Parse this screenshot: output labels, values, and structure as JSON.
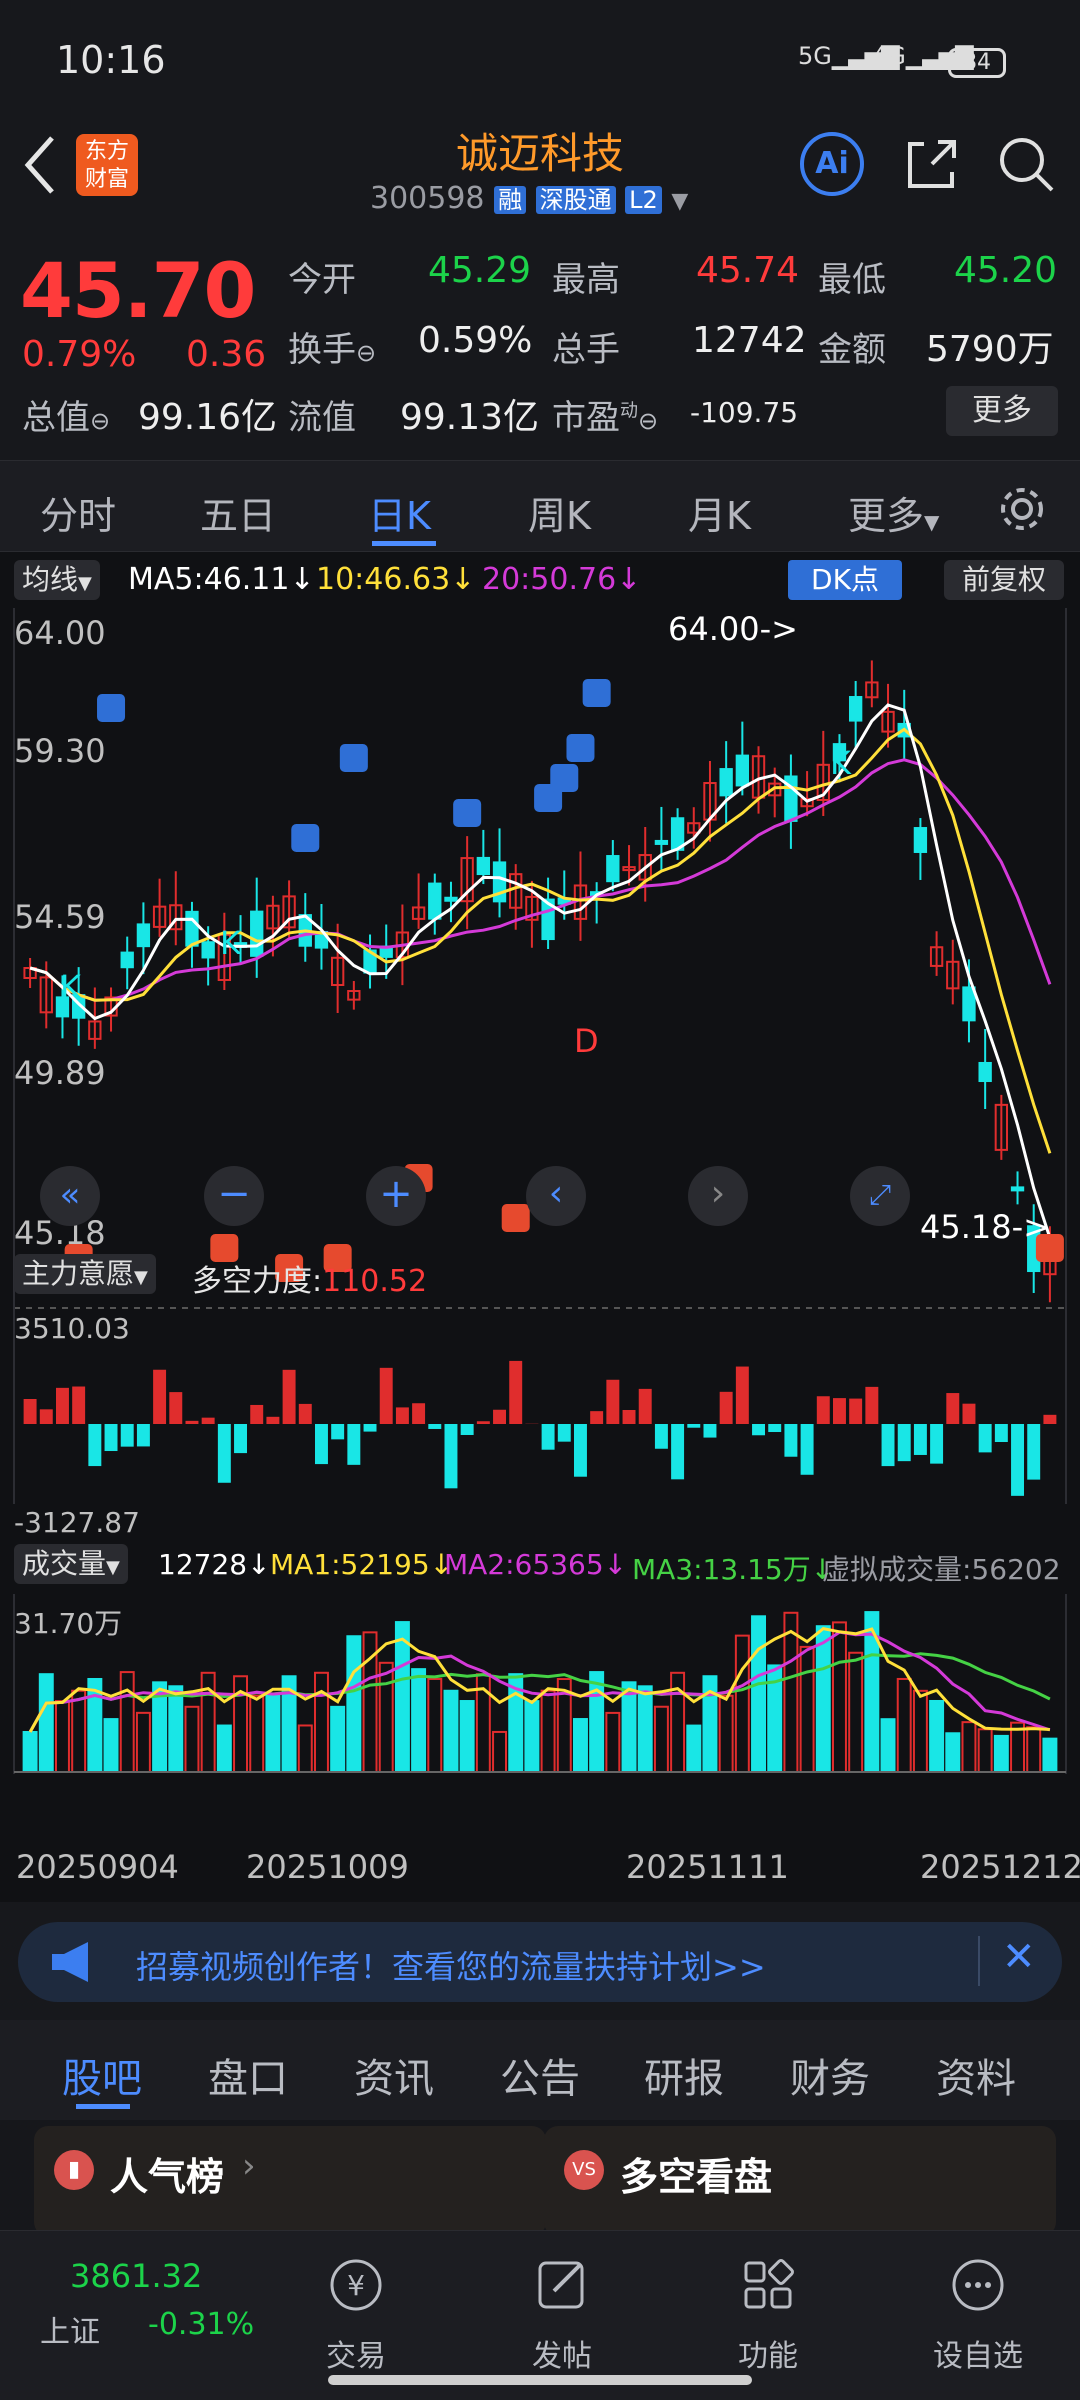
{
  "status": {
    "time": "10:16",
    "net1": "5G",
    "net2": "4G",
    "battery": "84"
  },
  "header": {
    "title": "诚迈科技",
    "code": "300598",
    "badges": [
      "融",
      "深股通",
      "L2"
    ],
    "logo_line1": "东方",
    "logo_line2": "财富",
    "ai": "Ai"
  },
  "quote": {
    "price": "45.70",
    "pct": "0.79%",
    "change": "0.36",
    "open_label": "今开",
    "open": "45.29",
    "high_label": "最高",
    "high": "45.74",
    "low_label": "最低",
    "low": "45.20",
    "turnover_label": "换手",
    "turnover": "0.59%",
    "volume_label": "总手",
    "volume": "12742",
    "amount_label": "金额",
    "amount": "5790万",
    "mktcap_label": "总值",
    "mktcap": "99.16亿",
    "float_label": "流值",
    "float": "99.13亿",
    "pe_label": "市盈",
    "pe_sup": "动",
    "pe": "-109.75",
    "more": "更多"
  },
  "tabs": [
    "分时",
    "五日",
    "日K",
    "周K",
    "月K",
    "更多"
  ],
  "active_tab": 2,
  "kline": {
    "ma_selector": "均线",
    "ma5": "MA5:46.11↓",
    "ma10": "10:46.63↓",
    "ma20": "20:50.76↓",
    "dk": "DK点",
    "adjust": "前复权",
    "y_labels": [
      "64.00",
      "59.30",
      "54.59",
      "49.89",
      "45.18"
    ],
    "high_tag": "64.00->",
    "low_tag": "45.18->",
    "k_marker": "K",
    "d_marker": "D",
    "colors": {
      "up": "#e02d2d",
      "down": "#19e6e6",
      "ma5": "#ffffff",
      "ma10": "#ffe03a",
      "ma20": "#d43ad8"
    }
  },
  "zhuli": {
    "selector": "主力意愿",
    "label": "多空力度:",
    "value": "110.52",
    "ymax": "3510.03",
    "ymin": "-3127.87"
  },
  "volume": {
    "selector": "成交量",
    "vol": "12728↓",
    "ma1": "MA1:52195↓",
    "ma2": "MA2:65365↓",
    "ma3": "MA3:13.15万↓",
    "virtual": "虚拟成交量:56202",
    "ymax": "31.70万",
    "dates": [
      "20250904",
      "20251009",
      "20251111",
      "20251212"
    ]
  },
  "banner": {
    "text": "招募视频创作者！查看您的流量扶持计划>>"
  },
  "bottom_tabs": [
    "股吧",
    "盘口",
    "资讯",
    "公告",
    "研报",
    "财务",
    "资料"
  ],
  "cards": [
    {
      "title": "人气榜"
    },
    {
      "title": "多空看盘"
    }
  ],
  "footer": {
    "index_value": "3861.32",
    "index_name": "上证",
    "index_pct": "-0.31%",
    "items": [
      "交易",
      "发帖",
      "功能",
      "设自选"
    ]
  }
}
